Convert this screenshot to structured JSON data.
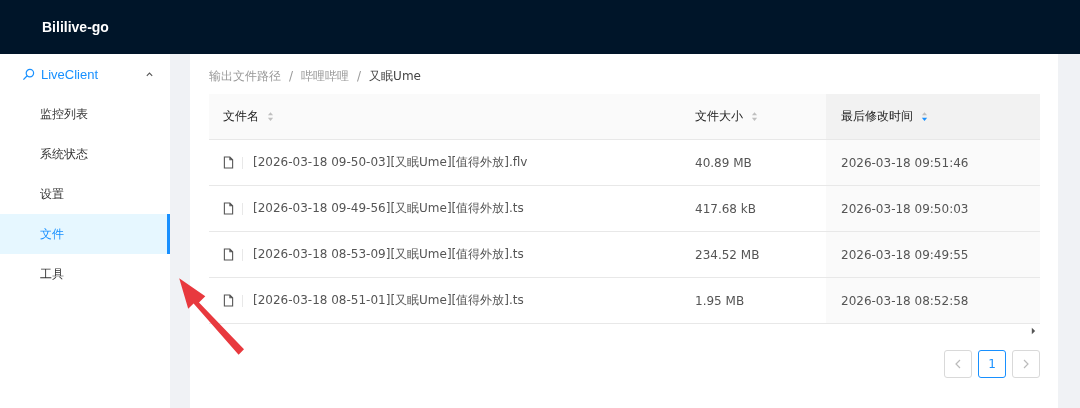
{
  "header": {
    "title": "Bililive-go"
  },
  "sidebar": {
    "group": {
      "label": "LiveClient",
      "expanded": true
    },
    "items": [
      {
        "label": "监控列表",
        "selected": false
      },
      {
        "label": "系统状态",
        "selected": false
      },
      {
        "label": "设置",
        "selected": false
      },
      {
        "label": "文件",
        "selected": true
      },
      {
        "label": "工具",
        "selected": false
      }
    ]
  },
  "breadcrumb": {
    "separator": "/",
    "items": [
      "输出文件路径",
      "哔哩哔哩",
      "又眠Ume"
    ]
  },
  "table": {
    "columns": [
      {
        "label": "文件名",
        "sorted": false
      },
      {
        "label": "文件大小",
        "sorted": false
      },
      {
        "label": "最后修改时间",
        "sorted": true
      }
    ],
    "rows": [
      {
        "name": "[2026-03-18 09-50-03][又眠Ume][值得外放].flv",
        "size": "40.89 MB",
        "modified": "2026-03-18 09:51:46"
      },
      {
        "name": "[2026-03-18 09-49-56][又眠Ume][值得外放].ts",
        "size": "417.68 kB",
        "modified": "2026-03-18 09:50:03"
      },
      {
        "name": "[2026-03-18 08-53-09][又眠Ume][值得外放].ts",
        "size": "234.52 MB",
        "modified": "2026-03-18 09:49:55"
      },
      {
        "name": "[2026-03-18 08-51-01][又眠Ume][值得外放].ts",
        "size": "1.95 MB",
        "modified": "2026-03-18 08:52:58"
      }
    ]
  },
  "pagination": {
    "pages": [
      {
        "label": "1",
        "selected": true
      }
    ]
  }
}
